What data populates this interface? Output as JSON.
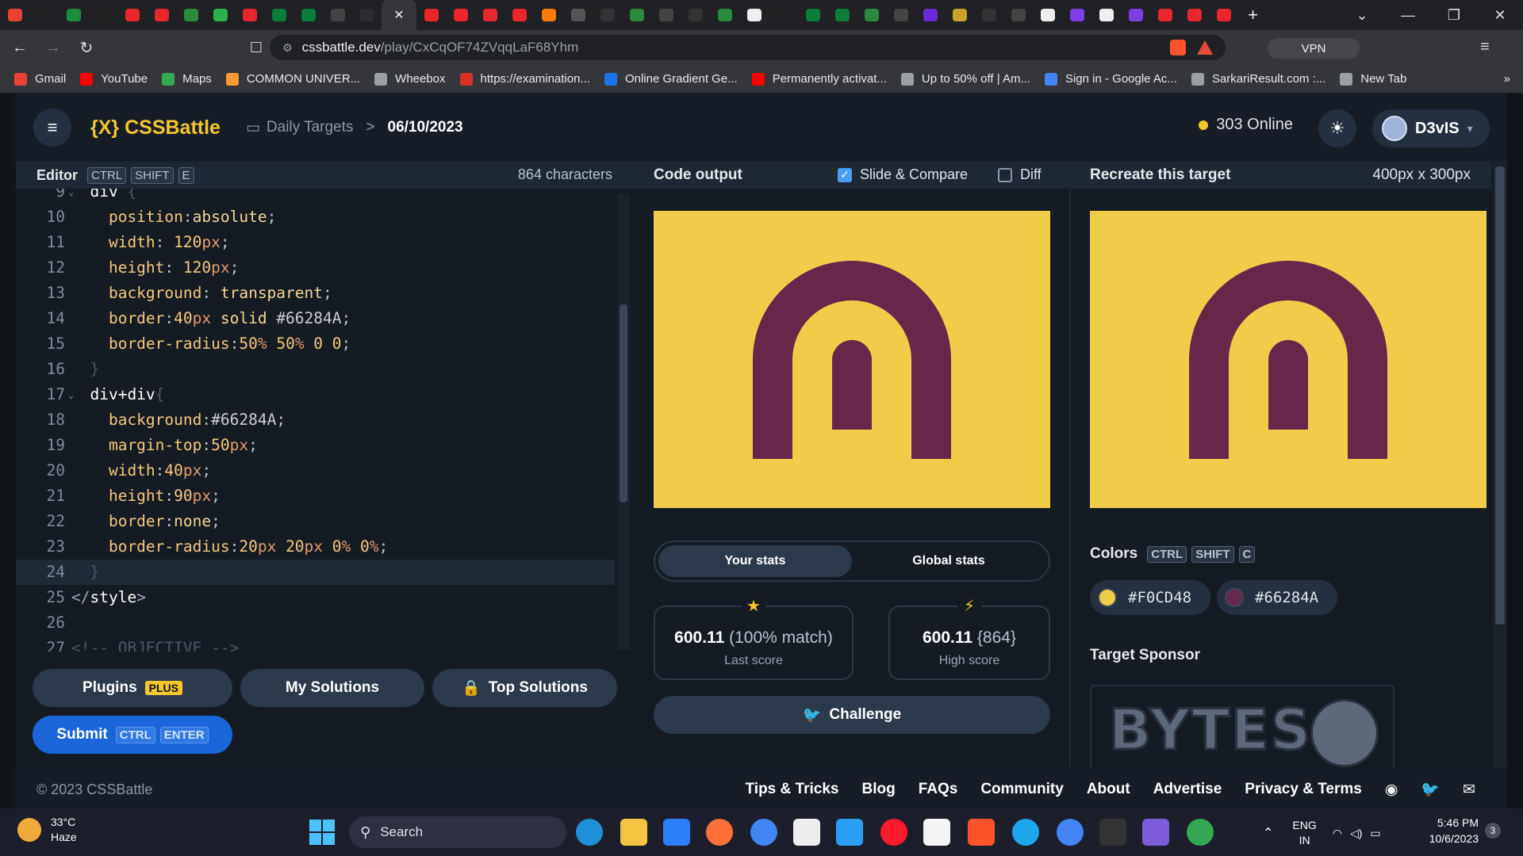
{
  "browser": {
    "active_tab_close": "✕",
    "url_host": "cssbattle.dev",
    "url_path": "/play/CxCqOF74ZVqqLaF68Yhm",
    "vpn_label": "VPN",
    "bookmarks": [
      {
        "label": "Gmail",
        "color": "#ea4335"
      },
      {
        "label": "YouTube",
        "color": "#ff0000"
      },
      {
        "label": "Maps",
        "color": "#34a853"
      },
      {
        "label": "COMMON UNIVER...",
        "color": "#ff9933"
      },
      {
        "label": "Wheebox",
        "color": "#9aa0a6"
      },
      {
        "label": "https://examination...",
        "color": "#d93025"
      },
      {
        "label": "Online Gradient Ge...",
        "color": "#1a73e8"
      },
      {
        "label": "Permanently activat...",
        "color": "#ff0000"
      },
      {
        "label": "Up to 50% off | Am...",
        "color": "#9aa0a6"
      },
      {
        "label": "Sign in - Google Ac...",
        "color": "#4285f4"
      },
      {
        "label": "SarkariResult.com :...",
        "color": "#9aa0a6"
      },
      {
        "label": "New Tab",
        "color": "#9aa0a6"
      }
    ],
    "bookmarks_more": "»"
  },
  "header": {
    "logo_mark": "{X}",
    "logo_text": "CSSBattle",
    "crumb_section": "Daily Targets",
    "crumb_sep": ">",
    "crumb_date": "06/10/2023",
    "online_text": "303 Online",
    "username": "D3vIS",
    "user_caret": "▾"
  },
  "editor": {
    "title": "Editor",
    "shortcut": [
      "CTRL",
      "SHIFT",
      "E"
    ],
    "char_count": "864 characters",
    "lines": [
      {
        "n": "9",
        "fold": true,
        "tokens": [
          [
            "  ",
            ""
          ],
          [
            "div",
            "sel"
          ],
          [
            " {",
            "cm"
          ]
        ]
      },
      {
        "n": "10",
        "tokens": [
          [
            "    position",
            "kw"
          ],
          [
            ":",
            "pun"
          ],
          [
            "absolute",
            "val"
          ],
          [
            ";",
            "pun"
          ]
        ]
      },
      {
        "n": "11",
        "tokens": [
          [
            "    width",
            "kw"
          ],
          [
            ": ",
            "pun"
          ],
          [
            "120",
            "num"
          ],
          [
            "px",
            "unit"
          ],
          [
            ";",
            "pun"
          ]
        ]
      },
      {
        "n": "12",
        "tokens": [
          [
            "    height",
            "kw"
          ],
          [
            ": ",
            "pun"
          ],
          [
            "120",
            "num"
          ],
          [
            "px",
            "unit"
          ],
          [
            ";",
            "pun"
          ]
        ]
      },
      {
        "n": "13",
        "tokens": [
          [
            "    background",
            "kw"
          ],
          [
            ": ",
            "pun"
          ],
          [
            "transparent",
            "val"
          ],
          [
            ";",
            "pun"
          ]
        ]
      },
      {
        "n": "14",
        "tokens": [
          [
            "    border",
            "kw"
          ],
          [
            ":",
            "pun"
          ],
          [
            "40",
            "num"
          ],
          [
            "px",
            "unit"
          ],
          [
            " solid ",
            "val"
          ],
          [
            "#66284A",
            "hex"
          ],
          [
            ";",
            "pun"
          ]
        ]
      },
      {
        "n": "15",
        "tokens": [
          [
            "    border-radius",
            "kw"
          ],
          [
            ":",
            "pun"
          ],
          [
            "50",
            "num"
          ],
          [
            "%",
            "unit"
          ],
          [
            " ",
            ""
          ],
          [
            "50",
            "num"
          ],
          [
            "%",
            "unit"
          ],
          [
            " 0 0",
            "num"
          ],
          [
            ";",
            "pun"
          ]
        ]
      },
      {
        "n": "16",
        "tokens": [
          [
            "  }",
            "cm"
          ]
        ]
      },
      {
        "n": "17",
        "fold": true,
        "tokens": [
          [
            "  ",
            ""
          ],
          [
            "div+div",
            "sel"
          ],
          [
            "{",
            "cm"
          ]
        ]
      },
      {
        "n": "18",
        "tokens": [
          [
            "    background",
            "kw"
          ],
          [
            ":",
            "pun"
          ],
          [
            "#66284A",
            "hex"
          ],
          [
            ";",
            "pun"
          ]
        ]
      },
      {
        "n": "19",
        "tokens": [
          [
            "    margin-top",
            "kw"
          ],
          [
            ":",
            "pun"
          ],
          [
            "50",
            "num"
          ],
          [
            "px",
            "unit"
          ],
          [
            ";",
            "pun"
          ]
        ]
      },
      {
        "n": "20",
        "tokens": [
          [
            "    width",
            "kw"
          ],
          [
            ":",
            "pun"
          ],
          [
            "40",
            "num"
          ],
          [
            "px",
            "unit"
          ],
          [
            ";",
            "pun"
          ]
        ]
      },
      {
        "n": "21",
        "tokens": [
          [
            "    height",
            "kw"
          ],
          [
            ":",
            "pun"
          ],
          [
            "90",
            "num"
          ],
          [
            "px",
            "unit"
          ],
          [
            ";",
            "pun"
          ]
        ]
      },
      {
        "n": "22",
        "tokens": [
          [
            "    border",
            "kw"
          ],
          [
            ":",
            "pun"
          ],
          [
            "none",
            "val"
          ],
          [
            ";",
            "pun"
          ]
        ]
      },
      {
        "n": "23",
        "tokens": [
          [
            "    border-radius",
            "kw"
          ],
          [
            ":",
            "pun"
          ],
          [
            "20",
            "num"
          ],
          [
            "px",
            "unit"
          ],
          [
            " ",
            ""
          ],
          [
            "20",
            "num"
          ],
          [
            "px",
            "unit"
          ],
          [
            " ",
            ""
          ],
          [
            "0",
            "num"
          ],
          [
            "%",
            "unit"
          ],
          [
            " ",
            ""
          ],
          [
            "0",
            "num"
          ],
          [
            "%",
            "unit"
          ],
          [
            ";",
            "pun"
          ]
        ]
      },
      {
        "n": "24",
        "current": true,
        "tokens": [
          [
            "  }",
            "cm"
          ]
        ]
      },
      {
        "n": "25",
        "tokens": [
          [
            "</",
            "tag"
          ],
          [
            "style",
            "sel"
          ],
          [
            ">",
            "tag"
          ]
        ]
      },
      {
        "n": "26",
        "tokens": [
          [
            "",
            ""
          ]
        ]
      },
      {
        "n": "27",
        "tokens": [
          [
            "<!-- OBJECTIVE -->",
            "cm"
          ]
        ]
      }
    ]
  },
  "actions": {
    "plugins": "Plugins",
    "plugins_badge": "PLUS",
    "my_solutions": "My Solutions",
    "top_solutions": "Top Solutions",
    "submit": "Submit",
    "submit_keys": [
      "CTRL",
      "ENTER"
    ]
  },
  "output": {
    "title": "Code output",
    "slide_compare": "Slide & Compare",
    "slide_compare_checked": true,
    "diff": "Diff",
    "diff_checked": false
  },
  "target": {
    "title": "Recreate this target",
    "size": "400px x 300px",
    "colors_title": "Colors",
    "colors_keys": [
      "CTRL",
      "SHIFT",
      "C"
    ],
    "colors": [
      {
        "hex": "#F0CD48"
      },
      {
        "hex": "#66284A"
      }
    ],
    "sponsor_title": "Target Sponsor",
    "sponsor_word": "BYTES"
  },
  "stats": {
    "tab_your": "Your stats",
    "tab_global": "Global stats",
    "last_score_value": "600.11",
    "last_score_detail": "(100% match)",
    "last_score_label": "Last score",
    "high_score_value": "600.11",
    "high_score_detail": "{864}",
    "high_score_label": "High score",
    "challenge": "Challenge"
  },
  "footer": {
    "copyright": "© 2023 CSSBattle",
    "links": [
      "Tips & Tricks",
      "Blog",
      "FAQs",
      "Community",
      "About",
      "Advertise",
      "Privacy & Terms"
    ]
  },
  "taskbar": {
    "temp": "33°C",
    "condition": "Haze",
    "search": "Search",
    "lang_top": "ENG",
    "lang_bottom": "IN",
    "time": "5:46 PM",
    "date": "10/6/2023",
    "notif_count": "3"
  },
  "colors": {
    "canvas_bg": "#F0CD48",
    "shape": "#66284A",
    "accent": "#F5C62B",
    "submit_blue": "#1A66D9"
  }
}
